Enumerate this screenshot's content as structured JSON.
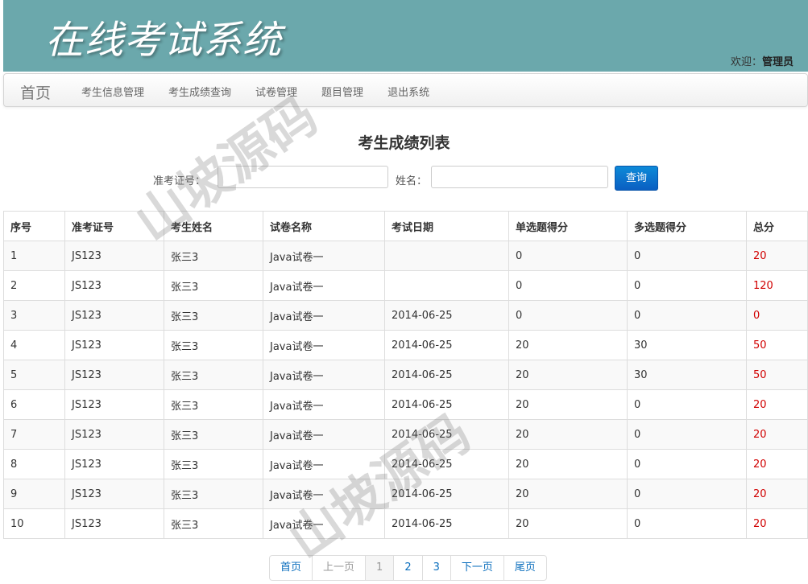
{
  "header": {
    "logo": "在线考试系统",
    "welcome_prefix": "欢迎：",
    "username": "管理员"
  },
  "nav": {
    "brand": "首页",
    "items": [
      "考生信息管理",
      "考生成绩查询",
      "试卷管理",
      "题目管理",
      "退出系统"
    ]
  },
  "page_title": "考生成绩列表",
  "search": {
    "id_label": "准考证号：",
    "id_value": "",
    "name_label": "姓名：",
    "name_value": "",
    "button": "查询"
  },
  "table": {
    "headers": [
      "序号",
      "准考证号",
      "考生姓名",
      "试卷名称",
      "考试日期",
      "单选题得分",
      "多选题得分",
      "总分"
    ],
    "rows": [
      [
        "1",
        "JS123",
        "张三3",
        "Java试卷一",
        "",
        "0",
        "0",
        "20"
      ],
      [
        "2",
        "JS123",
        "张三3",
        "Java试卷一",
        "",
        "0",
        "0",
        "120"
      ],
      [
        "3",
        "JS123",
        "张三3",
        "Java试卷一",
        "2014-06-25",
        "0",
        "0",
        "0"
      ],
      [
        "4",
        "JS123",
        "张三3",
        "Java试卷一",
        "2014-06-25",
        "20",
        "30",
        "50"
      ],
      [
        "5",
        "JS123",
        "张三3",
        "Java试卷一",
        "2014-06-25",
        "20",
        "30",
        "50"
      ],
      [
        "6",
        "JS123",
        "张三3",
        "Java试卷一",
        "2014-06-25",
        "20",
        "0",
        "20"
      ],
      [
        "7",
        "JS123",
        "张三3",
        "Java试卷一",
        "2014-06-25",
        "20",
        "0",
        "20"
      ],
      [
        "8",
        "JS123",
        "张三3",
        "Java试卷一",
        "2014-06-25",
        "20",
        "0",
        "20"
      ],
      [
        "9",
        "JS123",
        "张三3",
        "Java试卷一",
        "2014-06-25",
        "20",
        "0",
        "20"
      ],
      [
        "10",
        "JS123",
        "张三3",
        "Java试卷一",
        "2014-06-25",
        "20",
        "0",
        "20"
      ]
    ]
  },
  "pagination": {
    "first": "首页",
    "prev": "上一页",
    "pages": [
      "1",
      "2",
      "3"
    ],
    "next": "下一页",
    "last": "尾页"
  },
  "watermark": "山坡源码",
  "colors": {
    "header_bg": "#6ba8ac",
    "total_text": "#d10000",
    "button": "#0a6ebd"
  }
}
